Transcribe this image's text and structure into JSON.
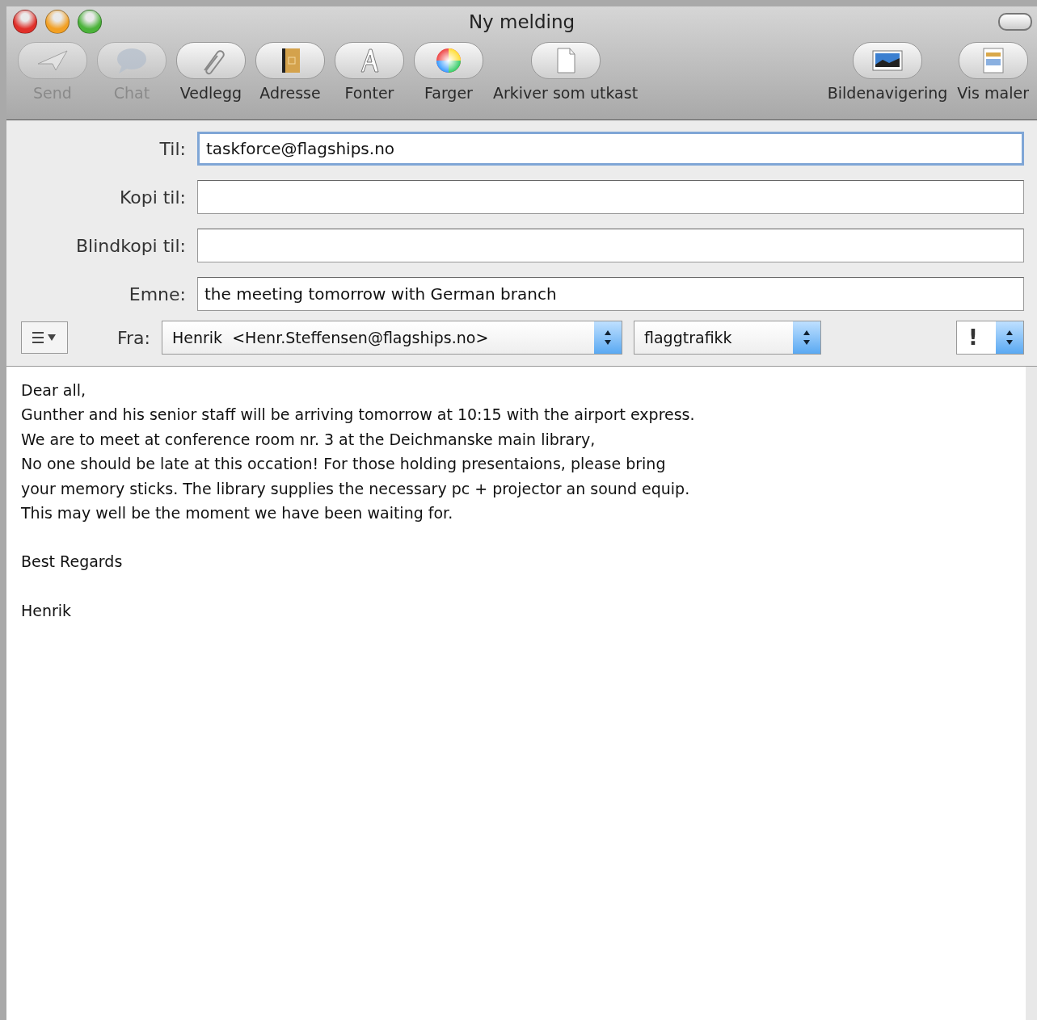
{
  "window": {
    "title": "Ny melding"
  },
  "toolbar": {
    "left": [
      {
        "label": "Send",
        "disabled": true
      },
      {
        "label": "Chat",
        "disabled": true
      },
      {
        "label": "Vedlegg",
        "disabled": false
      },
      {
        "label": "Adresse",
        "disabled": false
      },
      {
        "label": "Fonter",
        "disabled": false
      },
      {
        "label": "Farger",
        "disabled": false
      },
      {
        "label": "Arkiver som utkast",
        "disabled": false
      }
    ],
    "right": [
      {
        "label": "Bildenavigering",
        "disabled": false
      },
      {
        "label": "Vis maler",
        "disabled": false
      }
    ]
  },
  "fields": [
    {
      "label": "Til:",
      "value": "taskforce@flagships.no",
      "focused": true
    },
    {
      "label": "Kopi til:",
      "focused": false
    },
    {
      "label": "Blindkopi til:",
      "focused": false
    },
    {
      "label": "Emne:",
      "value": "the meeting tomorrow with German branch",
      "focused": false
    }
  ],
  "from": {
    "label": "Fra:",
    "account": "Henrik  <Henr.Steffensen@flagships.no>",
    "signature": "flaggtrafikk",
    "priority": "!"
  },
  "body": [
    [
      "Dear all,",
      "Gunther and his senior staff will be arriving tomorrow at 10:15 with the airport express.",
      "We are to meet at conference room nr. 3 at the Deichmanske main library,",
      "No one should be late at this occation! For those holding presentaions, please bring",
      "your memory sticks. The library supplies the necessary pc + projector an sound equip.",
      "This may well be the moment we have been waiting for."
    ],
    [
      "Best Regards"
    ],
    [
      "Henrik"
    ]
  ]
}
